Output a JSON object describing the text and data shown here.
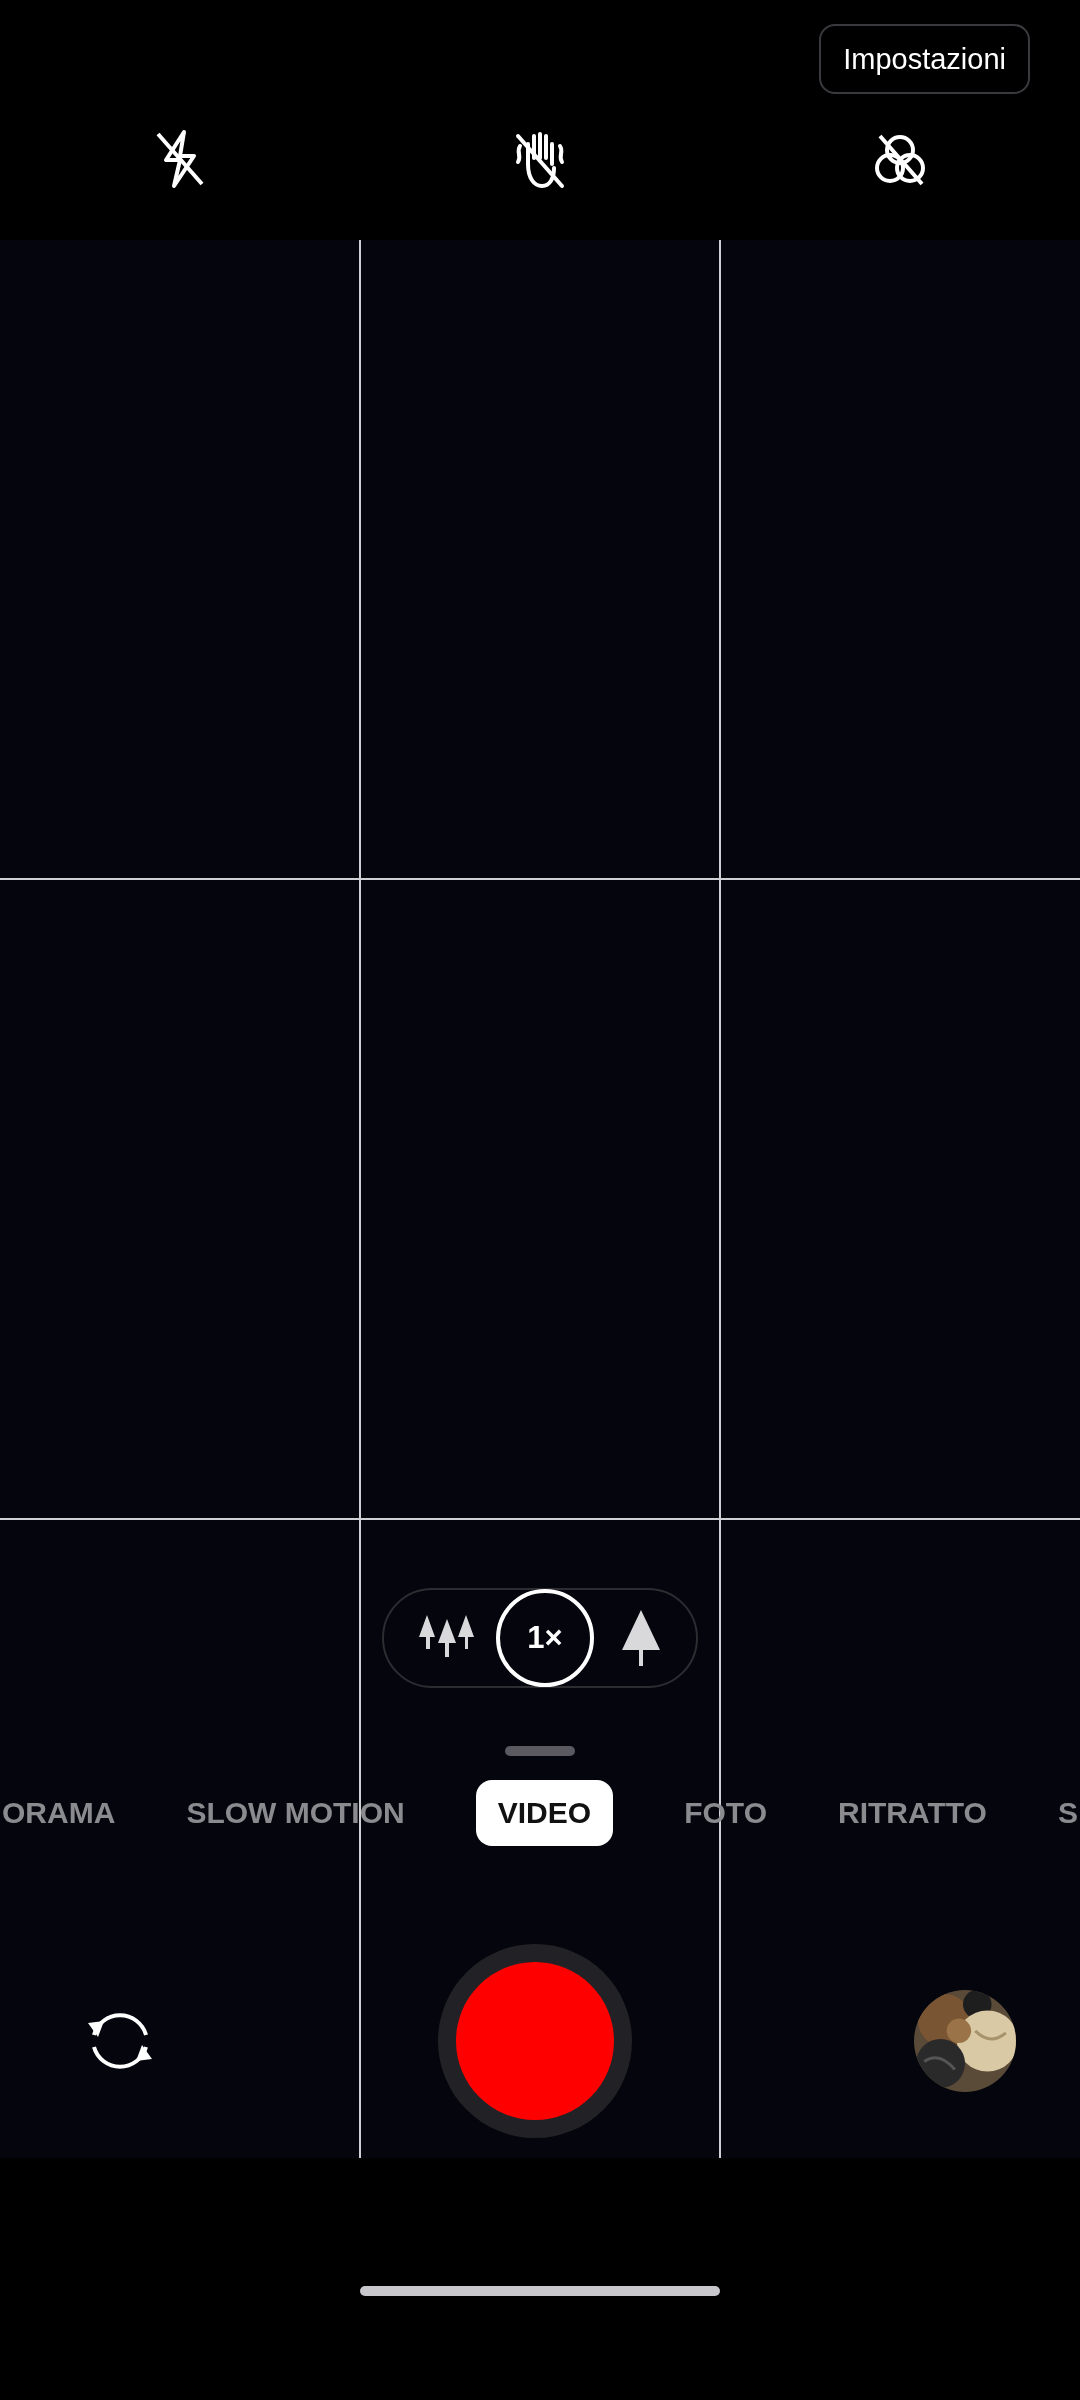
{
  "settings_button": {
    "label": "Impostazioni"
  },
  "zoom_levels": [
    {
      "kind": "wide",
      "selected": false
    },
    {
      "kind": "main",
      "label": "1×",
      "selected": true
    },
    {
      "kind": "tele",
      "selected": false
    }
  ],
  "modes": [
    {
      "label": "ORAMA",
      "selected": false
    },
    {
      "label": "SLOW MOTION",
      "selected": false
    },
    {
      "label": "VIDEO",
      "selected": true
    },
    {
      "label": "FOTO",
      "selected": false
    },
    {
      "label": "RITRATTO",
      "selected": false
    },
    {
      "label": "S",
      "selected": false
    }
  ]
}
